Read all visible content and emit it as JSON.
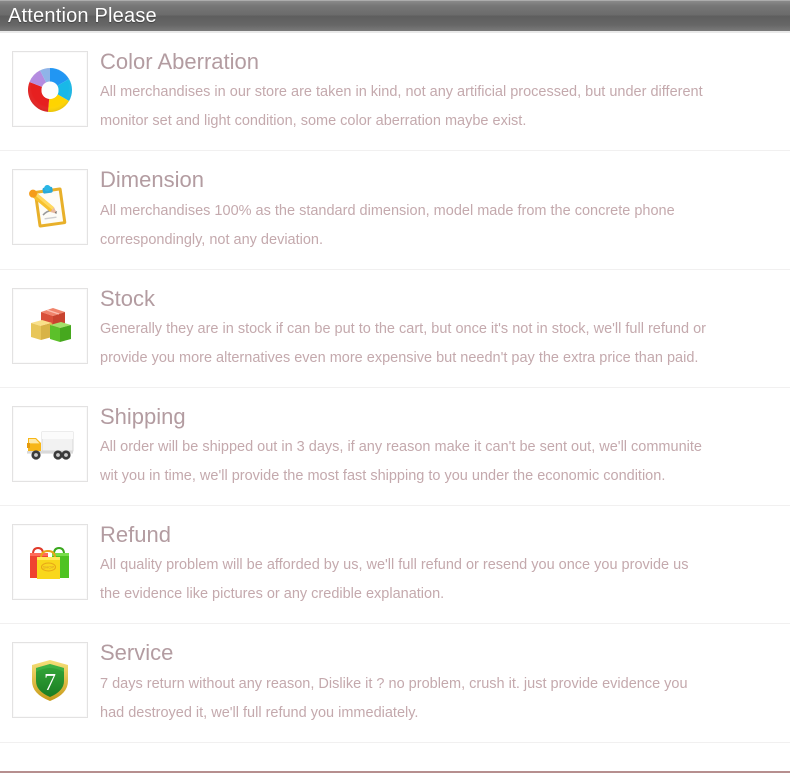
{
  "header": {
    "title": "Attention Please",
    "bg_start": "#8f8f8f",
    "bg_end": "#7a7a7a",
    "title_color": "#ffffff"
  },
  "styles": {
    "title_color": "#b39ca1",
    "desc_color": "#c4a9ad",
    "divider_color": "#f1f0f0",
    "icon_border_color": "#e3e2e2"
  },
  "rows": [
    {
      "icon": "color-wheel-icon",
      "title": "Color Aberration",
      "line1": "All merchandises in our store are taken in kind, not any artificial processed, but under different",
      "line2": "monitor set and light condition, some color aberration maybe exist."
    },
    {
      "icon": "clipboard-pencil-icon",
      "title": "Dimension",
      "line1": "All merchandises 100% as the standard dimension, model made from the concrete phone",
      "line2": "correspondingly, not any deviation."
    },
    {
      "icon": "boxes-icon",
      "title": "Stock",
      "line1": "Generally they are in stock if can be put to the cart, but once it's not in stock, we'll full refund or",
      "line2": "provide you more alternatives even more expensive but needn't pay the extra price than paid."
    },
    {
      "icon": "delivery-truck-icon",
      "title": "Shipping",
      "line1": "All order will be shipped out in 3 days, if any reason make it can't be sent out, we'll communite",
      "line2": "wit you in time, we'll provide the most fast shipping to you under the economic condition."
    },
    {
      "icon": "shopping-bags-icon",
      "title": "Refund",
      "line1": "All quality problem will be afforded by us, we'll full refund or resend you once you provide us",
      "line2": "the evidence like pictures or any credible explanation."
    },
    {
      "icon": "shield-seven-icon",
      "title": "Service",
      "line1": "7 days return without any reason, Dislike it ? no problem, crush it. just provide evidence you",
      "line2": "had destroyed it, we'll full refund you immediately."
    }
  ]
}
